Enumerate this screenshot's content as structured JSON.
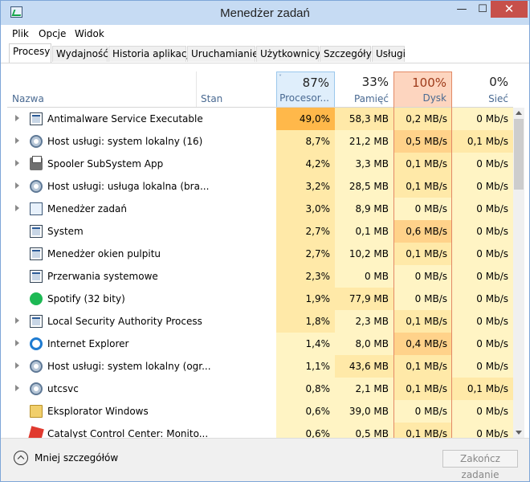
{
  "window": {
    "title": "Menedżer zadań",
    "controls": {
      "minimize": "—",
      "maximize": "☐",
      "close": "✕"
    }
  },
  "menu": [
    "Plik",
    "Opcje",
    "Widok"
  ],
  "tabs": [
    "Procesy",
    "Wydajność",
    "Historia aplikacji",
    "Uruchamianie",
    "Użytkownicy",
    "Szczegóły",
    "Usługi"
  ],
  "active_tab": "Procesy",
  "columns": {
    "name": "Nazwa",
    "status": "Stan",
    "cpu": {
      "pct": "87%",
      "label": "Procesor..."
    },
    "memory": {
      "pct": "33%",
      "label": "Pamięć"
    },
    "disk": {
      "pct": "100%",
      "label": "Dysk"
    },
    "network": {
      "pct": "0%",
      "label": "Sieć"
    }
  },
  "processes": [
    {
      "name": "Antimalware Service Executable",
      "icon": "service-icon",
      "expandable": true,
      "cpu": "49,0%",
      "mem": "58,3 MB",
      "disk": "0,2 MB/s",
      "net": "0 Mb/s"
    },
    {
      "name": "Host usługi: system lokalny (16)",
      "icon": "gear-icon",
      "expandable": true,
      "cpu": "8,7%",
      "mem": "21,2 MB",
      "disk": "0,5 MB/s",
      "net": "0,1 Mb/s"
    },
    {
      "name": "Spooler SubSystem App",
      "icon": "printer-icon",
      "expandable": true,
      "cpu": "4,2%",
      "mem": "3,3 MB",
      "disk": "0,1 MB/s",
      "net": "0 Mb/s"
    },
    {
      "name": "Host usługi: usługa lokalna (bra...",
      "icon": "gear-icon",
      "expandable": true,
      "cpu": "3,2%",
      "mem": "28,5 MB",
      "disk": "0,1 MB/s",
      "net": "0 Mb/s"
    },
    {
      "name": "Menedżer zadań",
      "icon": "task-manager-icon",
      "expandable": true,
      "cpu": "3,0%",
      "mem": "8,9 MB",
      "disk": "0 MB/s",
      "net": "0 Mb/s"
    },
    {
      "name": "System",
      "icon": "service-icon",
      "expandable": false,
      "cpu": "2,7%",
      "mem": "0,1 MB",
      "disk": "0,6 MB/s",
      "net": "0 Mb/s"
    },
    {
      "name": "Menedżer okien pulpitu",
      "icon": "service-icon",
      "expandable": false,
      "cpu": "2,7%",
      "mem": "10,2 MB",
      "disk": "0,1 MB/s",
      "net": "0 Mb/s"
    },
    {
      "name": "Przerwania systemowe",
      "icon": "service-icon",
      "expandable": false,
      "cpu": "2,3%",
      "mem": "0 MB",
      "disk": "0 MB/s",
      "net": "0 Mb/s"
    },
    {
      "name": "Spotify (32 bity)",
      "icon": "spotify-icon",
      "expandable": false,
      "cpu": "1,9%",
      "mem": "77,9 MB",
      "disk": "0 MB/s",
      "net": "0 Mb/s"
    },
    {
      "name": "Local Security Authority Process",
      "icon": "service-icon",
      "expandable": true,
      "cpu": "1,8%",
      "mem": "2,3 MB",
      "disk": "0,1 MB/s",
      "net": "0 Mb/s"
    },
    {
      "name": "Internet Explorer",
      "icon": "internet-explorer-icon",
      "expandable": true,
      "cpu": "1,4%",
      "mem": "8,0 MB",
      "disk": "0,4 MB/s",
      "net": "0 Mb/s"
    },
    {
      "name": "Host usługi: system lokalny (ogr...",
      "icon": "gear-icon",
      "expandable": true,
      "cpu": "1,1%",
      "mem": "43,6 MB",
      "disk": "0,1 MB/s",
      "net": "0 Mb/s"
    },
    {
      "name": "utcsvc",
      "icon": "gear-icon",
      "expandable": true,
      "cpu": "0,8%",
      "mem": "2,1 MB",
      "disk": "0,1 MB/s",
      "net": "0,1 Mb/s"
    },
    {
      "name": "Eksplorator Windows",
      "icon": "folder-icon",
      "expandable": false,
      "cpu": "0,6%",
      "mem": "39,0 MB",
      "disk": "0 MB/s",
      "net": "0 Mb/s"
    },
    {
      "name": "Catalyst Control Center: Monito...",
      "icon": "amd-icon",
      "expandable": false,
      "cpu": "0,6%",
      "mem": "0,5 MB",
      "disk": "0,1 MB/s",
      "net": "0 Mb/s"
    }
  ],
  "footer": {
    "fewer_details": "Mniej szczegółów",
    "end_task": "Zakończ zadanie"
  },
  "colors": {
    "heat_low": "#fff4c4",
    "heat_mid": "#ffe9a8",
    "heat_high": "#ffd28a",
    "cpu_hot": "#ffb84a",
    "disk_header": "#fdd5bf",
    "cpu_header": "#dfeefb"
  }
}
